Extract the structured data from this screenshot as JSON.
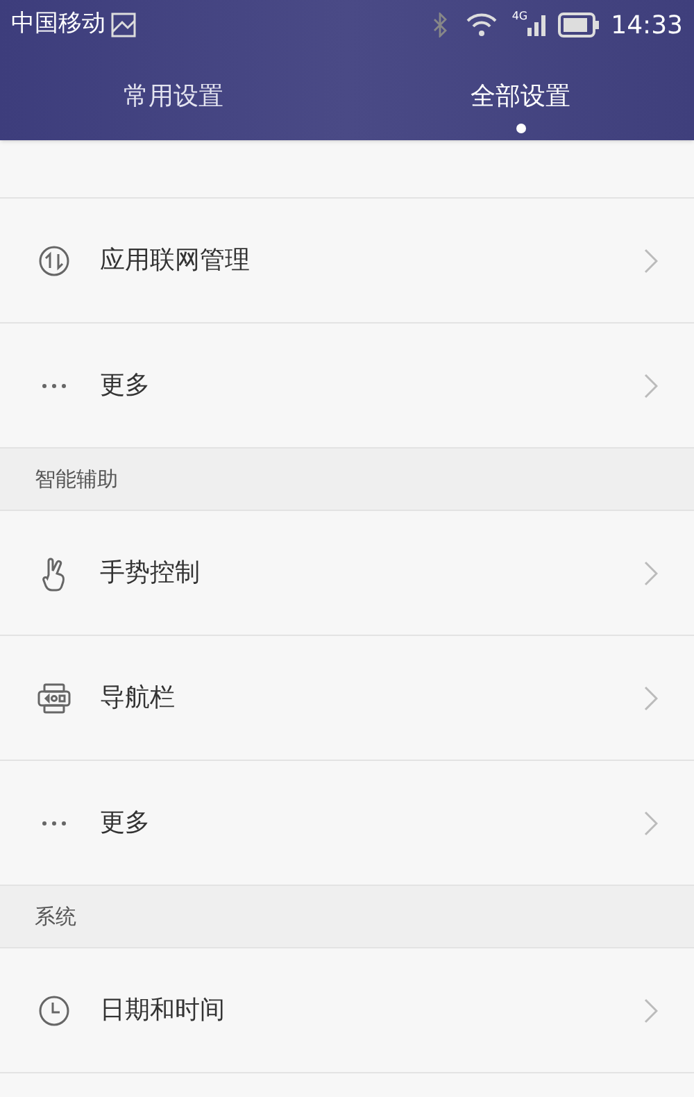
{
  "status_bar": {
    "carrier": "中国移动",
    "time": "14:33",
    "network": "4G"
  },
  "tabs": [
    {
      "label": "常用设置",
      "selected": false
    },
    {
      "label": "全部设置",
      "selected": true
    }
  ],
  "list": [
    {
      "kind": "network",
      "label": "应用联网管理"
    },
    {
      "kind": "more",
      "label": "更多"
    },
    {
      "kind": "section",
      "label": "智能辅助"
    },
    {
      "kind": "gesture",
      "label": "手势控制"
    },
    {
      "kind": "navbar",
      "label": "导航栏"
    },
    {
      "kind": "more",
      "label": "更多"
    },
    {
      "kind": "section",
      "label": "系统"
    },
    {
      "kind": "clock",
      "label": "日期和时间"
    }
  ]
}
